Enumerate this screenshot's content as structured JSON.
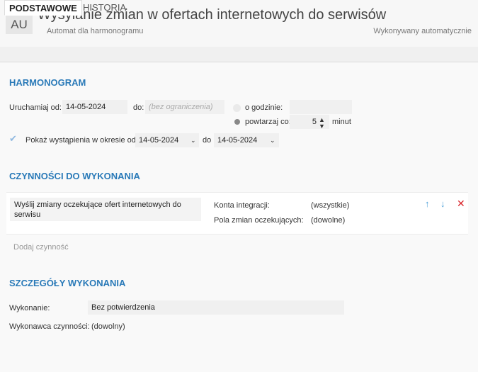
{
  "header": {
    "avatar": "AU",
    "title": "Wysyłanie zmian w ofertach internetowych do serwisów",
    "subtitle": "Automat dla harmonogramu",
    "status": "Wykonywany automatycznie"
  },
  "tabs": [
    {
      "label": "PODSTAWOWE",
      "active": true
    },
    {
      "label": "HISTORIA",
      "active": false
    }
  ],
  "schedule": {
    "heading": "HARMONOGRAM",
    "run_from_label": "Uruchamiaj od:",
    "run_from_value": "14-05-2024",
    "to_label": "do:",
    "to_placeholder": "(bez ograniczenia)",
    "at_hour_label": "o godzinie:",
    "at_hour_value": "",
    "repeat_label": "powtarzaj co:",
    "repeat_value": "5",
    "repeat_unit": "minut",
    "repeat_selected": true,
    "show_label": "Pokaż wystąpienia w okresie od",
    "show_from": "14-05-2024",
    "show_to_label": "do",
    "show_to": "14-05-2024"
  },
  "actions": {
    "heading": "CZYNNOŚCI DO WYKONANIA",
    "items": [
      {
        "name": "Wyślij zmiany oczekujące ofert internetowych do serwisu",
        "param1_label": "Konta integracji:",
        "param1_value": "(wszystkie)",
        "param2_label": "Pola zmian oczekujących:",
        "param2_value": "(dowolne)"
      }
    ],
    "add_label": "Dodaj czynność"
  },
  "details": {
    "heading": "SZCZEGÓŁY WYKONANIA",
    "execution_label": "Wykonanie:",
    "execution_value": "Bez potwierdzenia",
    "executor_label": "Wykonawca czynności:",
    "executor_value": "(dowolny)"
  },
  "colors": {
    "accent": "#2a7ab8",
    "delete": "#d9262c",
    "arrow": "#4a9fd8"
  }
}
